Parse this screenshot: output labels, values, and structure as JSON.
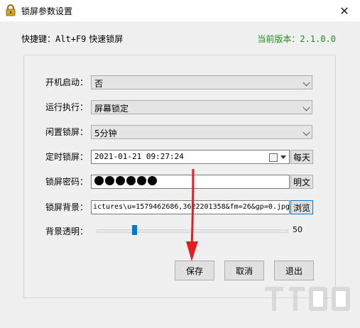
{
  "window": {
    "title": "锁屏参数设置",
    "close_label": "✕"
  },
  "header": {
    "hotkey_label": "快捷键：",
    "hotkey_value": "Alt+F9",
    "hotkey_action": "快速锁屏",
    "version_label": "当前版本：",
    "version_value": "2.1.0.0"
  },
  "form": {
    "startup": {
      "label": "开机启动：",
      "value": "否"
    },
    "action": {
      "label": "运行执行：",
      "value": "屏幕锁定"
    },
    "idle": {
      "label": "闲置锁屏：",
      "value": "5分钟"
    },
    "timed": {
      "label": "定时锁屏：",
      "value": "2021-01-21 09:27:24",
      "repeat_button": "每天"
    },
    "password": {
      "label": "锁屏密码：",
      "masked_chars": 6,
      "toggle_button": "明文"
    },
    "background": {
      "label": "锁屏背景：",
      "path": "ictures\\u=1579462686,3622201358&fm=26&gp=0.jpg",
      "browse_button": "浏览"
    },
    "opacity": {
      "label": "背景透明：",
      "value": "50"
    }
  },
  "buttons": {
    "save": "保存",
    "cancel": "取消",
    "exit": "退出"
  },
  "colors": {
    "accent": "#0078d7",
    "version_green": "#1e8a1e",
    "arrow_red": "#e02020"
  }
}
